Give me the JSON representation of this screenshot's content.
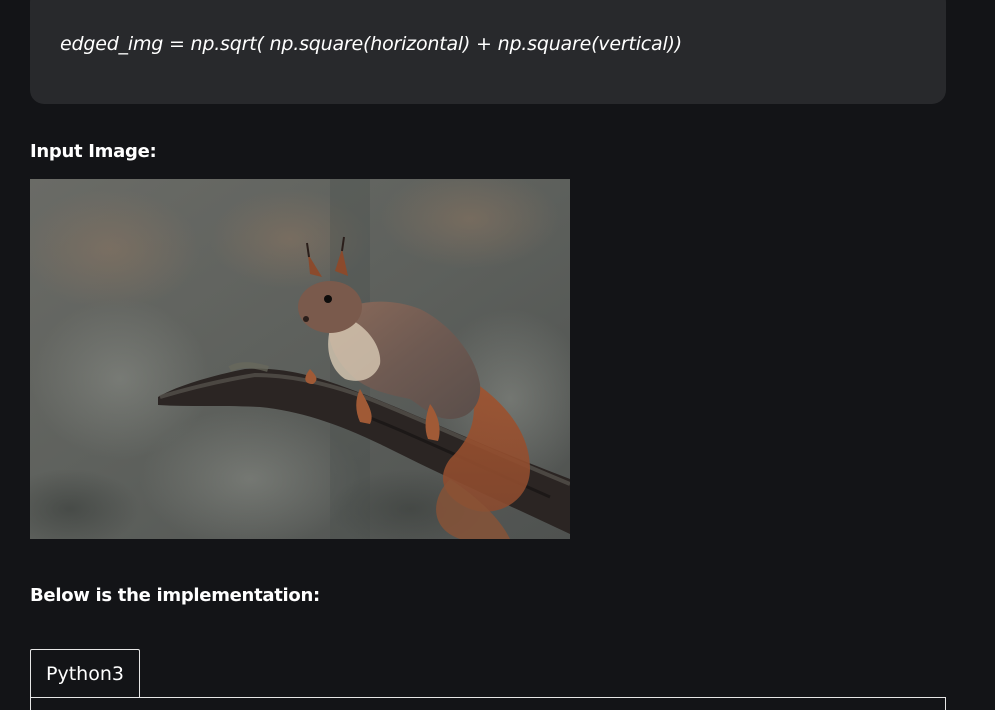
{
  "formula": {
    "code": "edged_img = np.sqrt( np.square(horizontal) + np.square(vertical))"
  },
  "headings": {
    "input_image": "Input Image:",
    "implementation": "Below is the implementation:"
  },
  "image": {
    "subject": "red squirrel on branch"
  },
  "tabs": {
    "active_label": "Python3"
  }
}
